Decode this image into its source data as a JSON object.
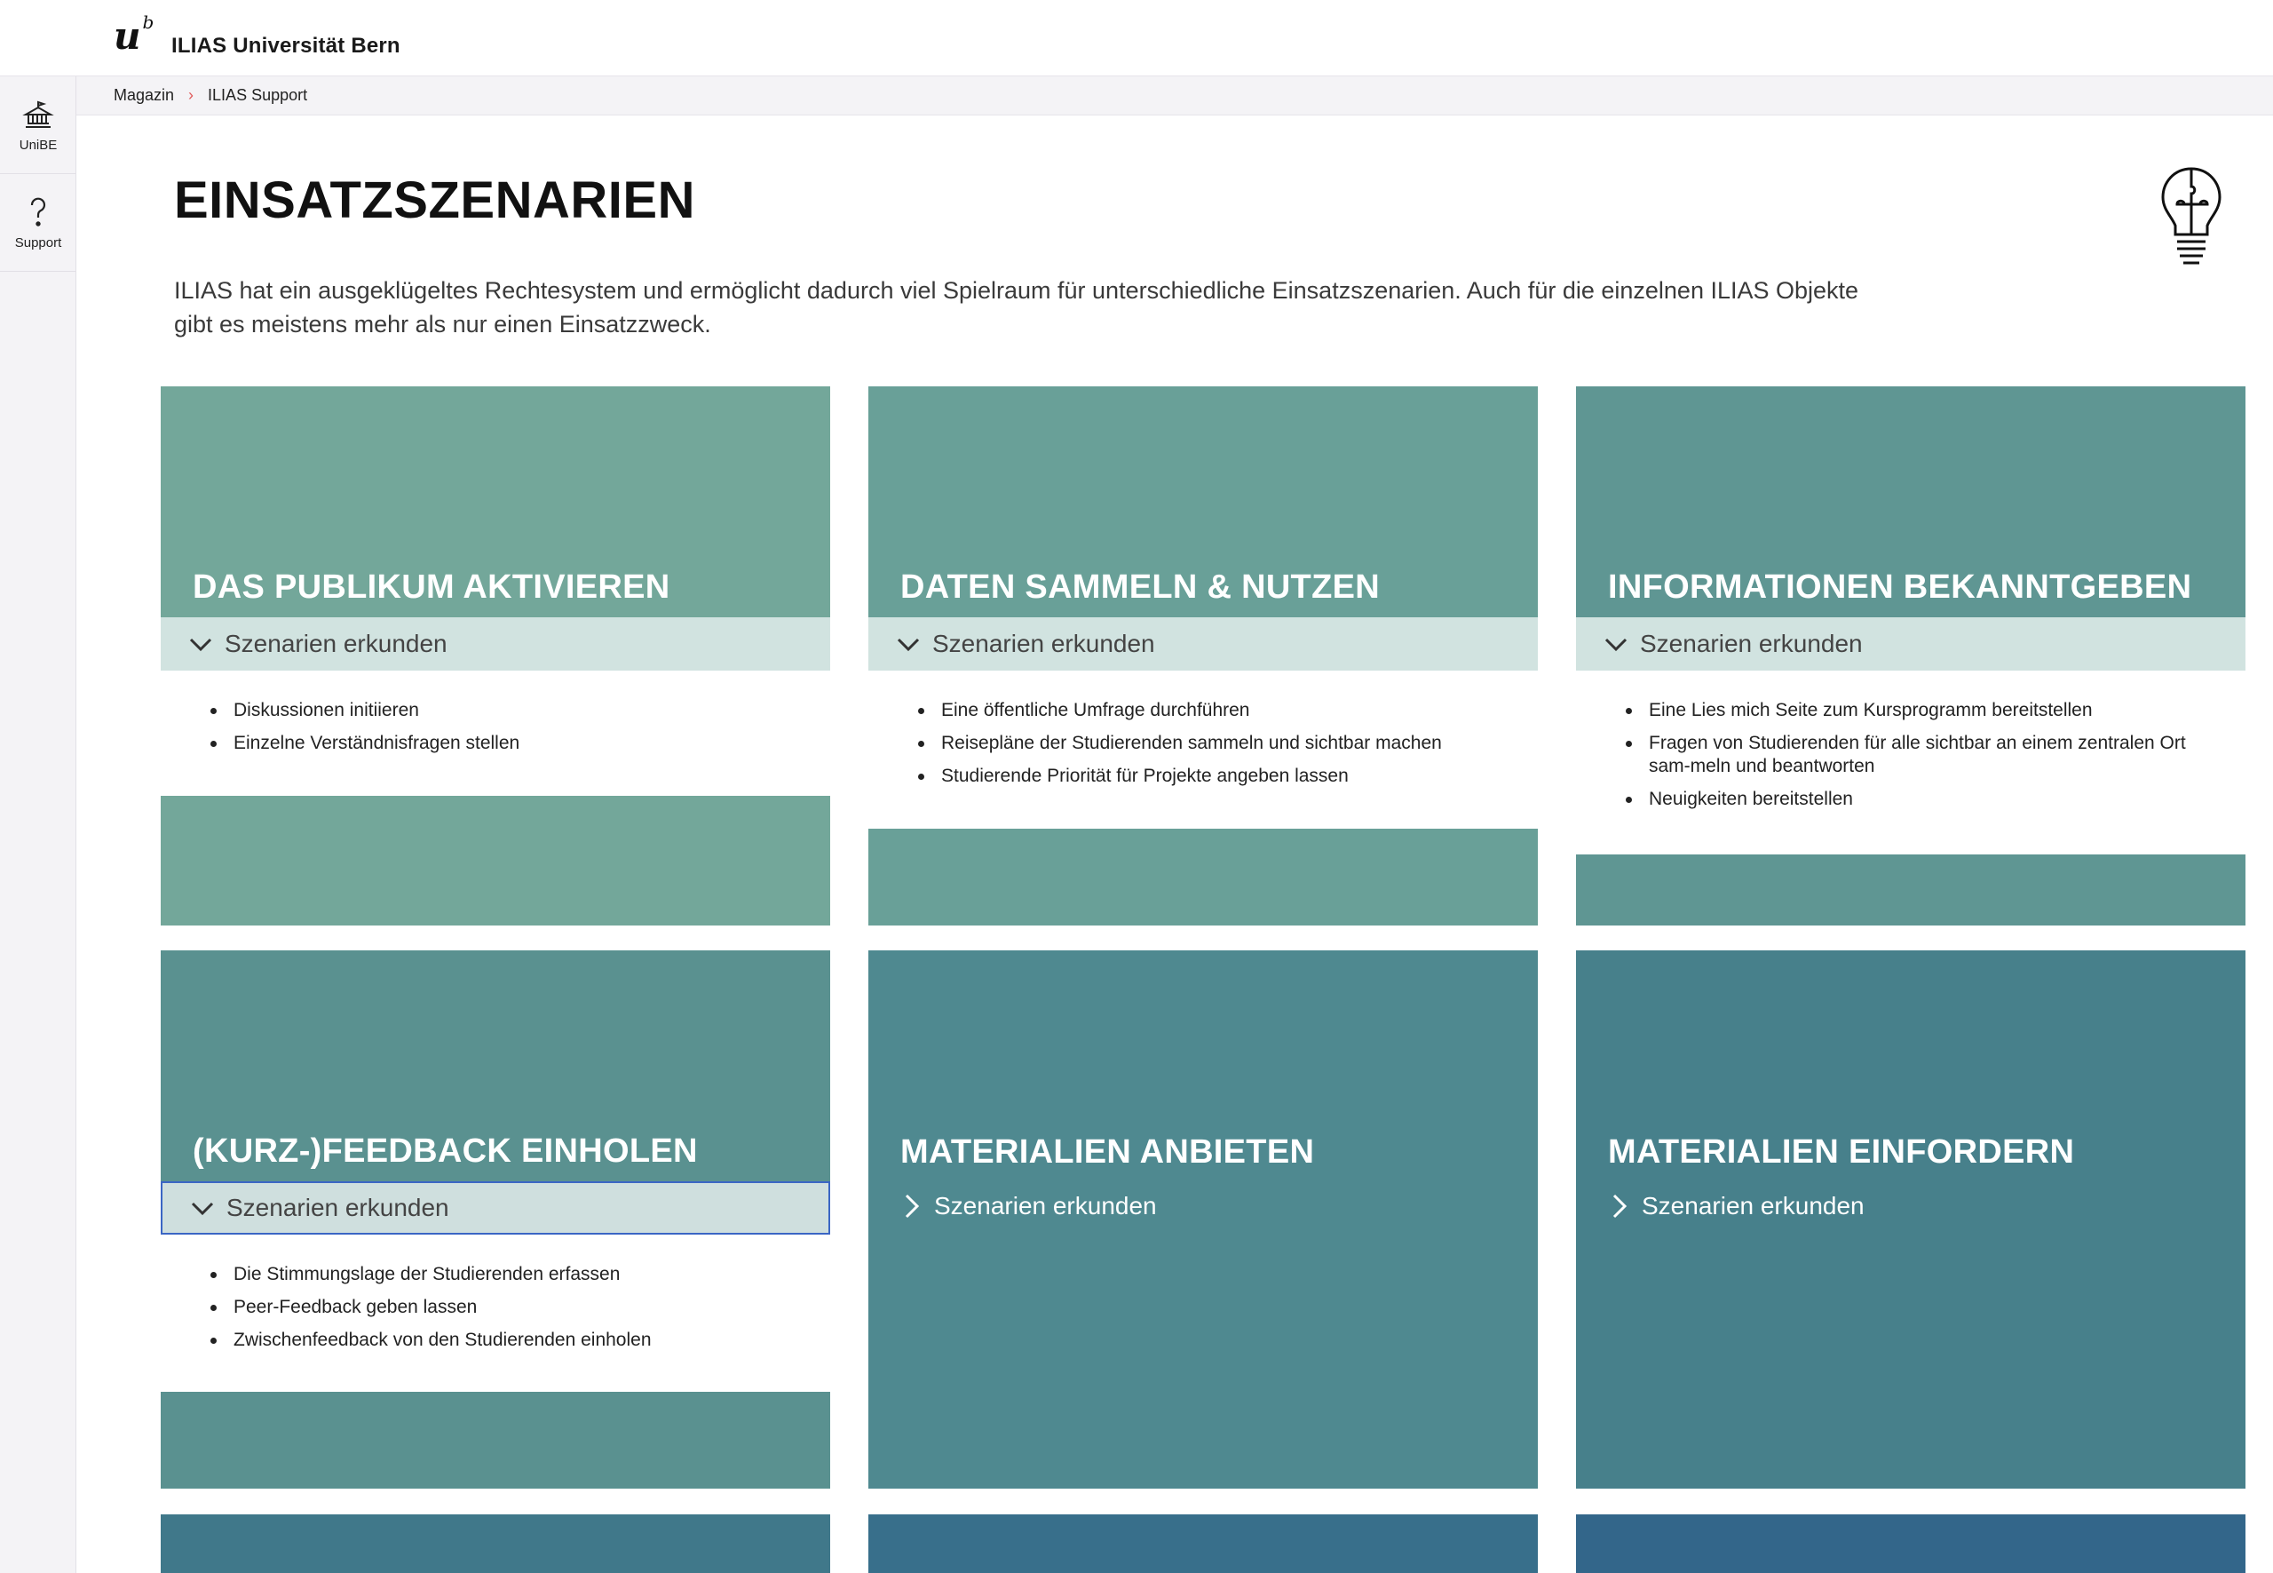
{
  "header": {
    "logo_text": "u",
    "logo_sup": "b",
    "site_title": "ILIAS Universität Bern"
  },
  "sidebar": {
    "items": [
      {
        "label": "UniBE",
        "icon": "building-icon"
      },
      {
        "label": "Support",
        "icon": "question-icon"
      }
    ]
  },
  "breadcrumb": {
    "items": [
      "Magazin",
      "ILIAS Support"
    ],
    "separator": "›"
  },
  "main": {
    "title": "EINSATZSZENARIEN",
    "intro": "ILIAS hat ein ausgeklügeltes Rechtesystem und ermöglicht dadurch viel Spielraum für unterschiedliche Einsatzszenarien. Auch für die einzelnen ILIAS Objekte gibt es meistens mehr als nur einen Einsatzzweck.",
    "tiles": [
      {
        "title": "DAS PUBLIKUM AKTIVIEREN",
        "toggle": "Szenarien erkunden",
        "expanded": true,
        "color": "#73a79a",
        "items": [
          "Diskussionen initiieren",
          "Einzelne Verständnisfragen stellen"
        ]
      },
      {
        "title": "DATEN SAMMELN & NUTZEN",
        "toggle": "Szenarien erkunden",
        "expanded": true,
        "color": "#69a098",
        "items": [
          "Eine öffentliche Umfrage durchführen",
          "Reisepläne der Studierenden sammeln und sichtbar machen",
          "Studierende Priorität für Projekte angeben lassen"
        ]
      },
      {
        "title": "INFORMATIONEN BEKANNTGEBEN",
        "toggle": "Szenarien erkunden",
        "expanded": true,
        "color": "#5f9693",
        "items": [
          "Eine Lies mich Seite zum Kursprogramm bereitstellen",
          "Fragen von Studierenden für alle sichtbar an einem zentralen Ort sam-meln und beantworten",
          "Neuigkeiten bereitstellen"
        ]
      },
      {
        "title": "(KURZ-)FEEDBACK EINHOLEN",
        "toggle": "Szenarien erkunden",
        "expanded": true,
        "color": "#5a9190",
        "items": [
          "Die Stimmungslage der Studierenden erfassen",
          "Peer-Feedback geben lassen",
          "Zwischenfeedback von den Studierenden einholen"
        ]
      },
      {
        "title": "MATERIALIEN ANBIETEN",
        "toggle": "Szenarien erkunden",
        "expanded": false,
        "color": "#4f8990"
      },
      {
        "title": "MATERIALIEN EINFORDERN",
        "toggle": "Szenarien erkunden",
        "expanded": false,
        "color": "#47808b"
      }
    ],
    "stub_colors": [
      "#40788a",
      "#386f8b",
      "#33668a"
    ]
  }
}
